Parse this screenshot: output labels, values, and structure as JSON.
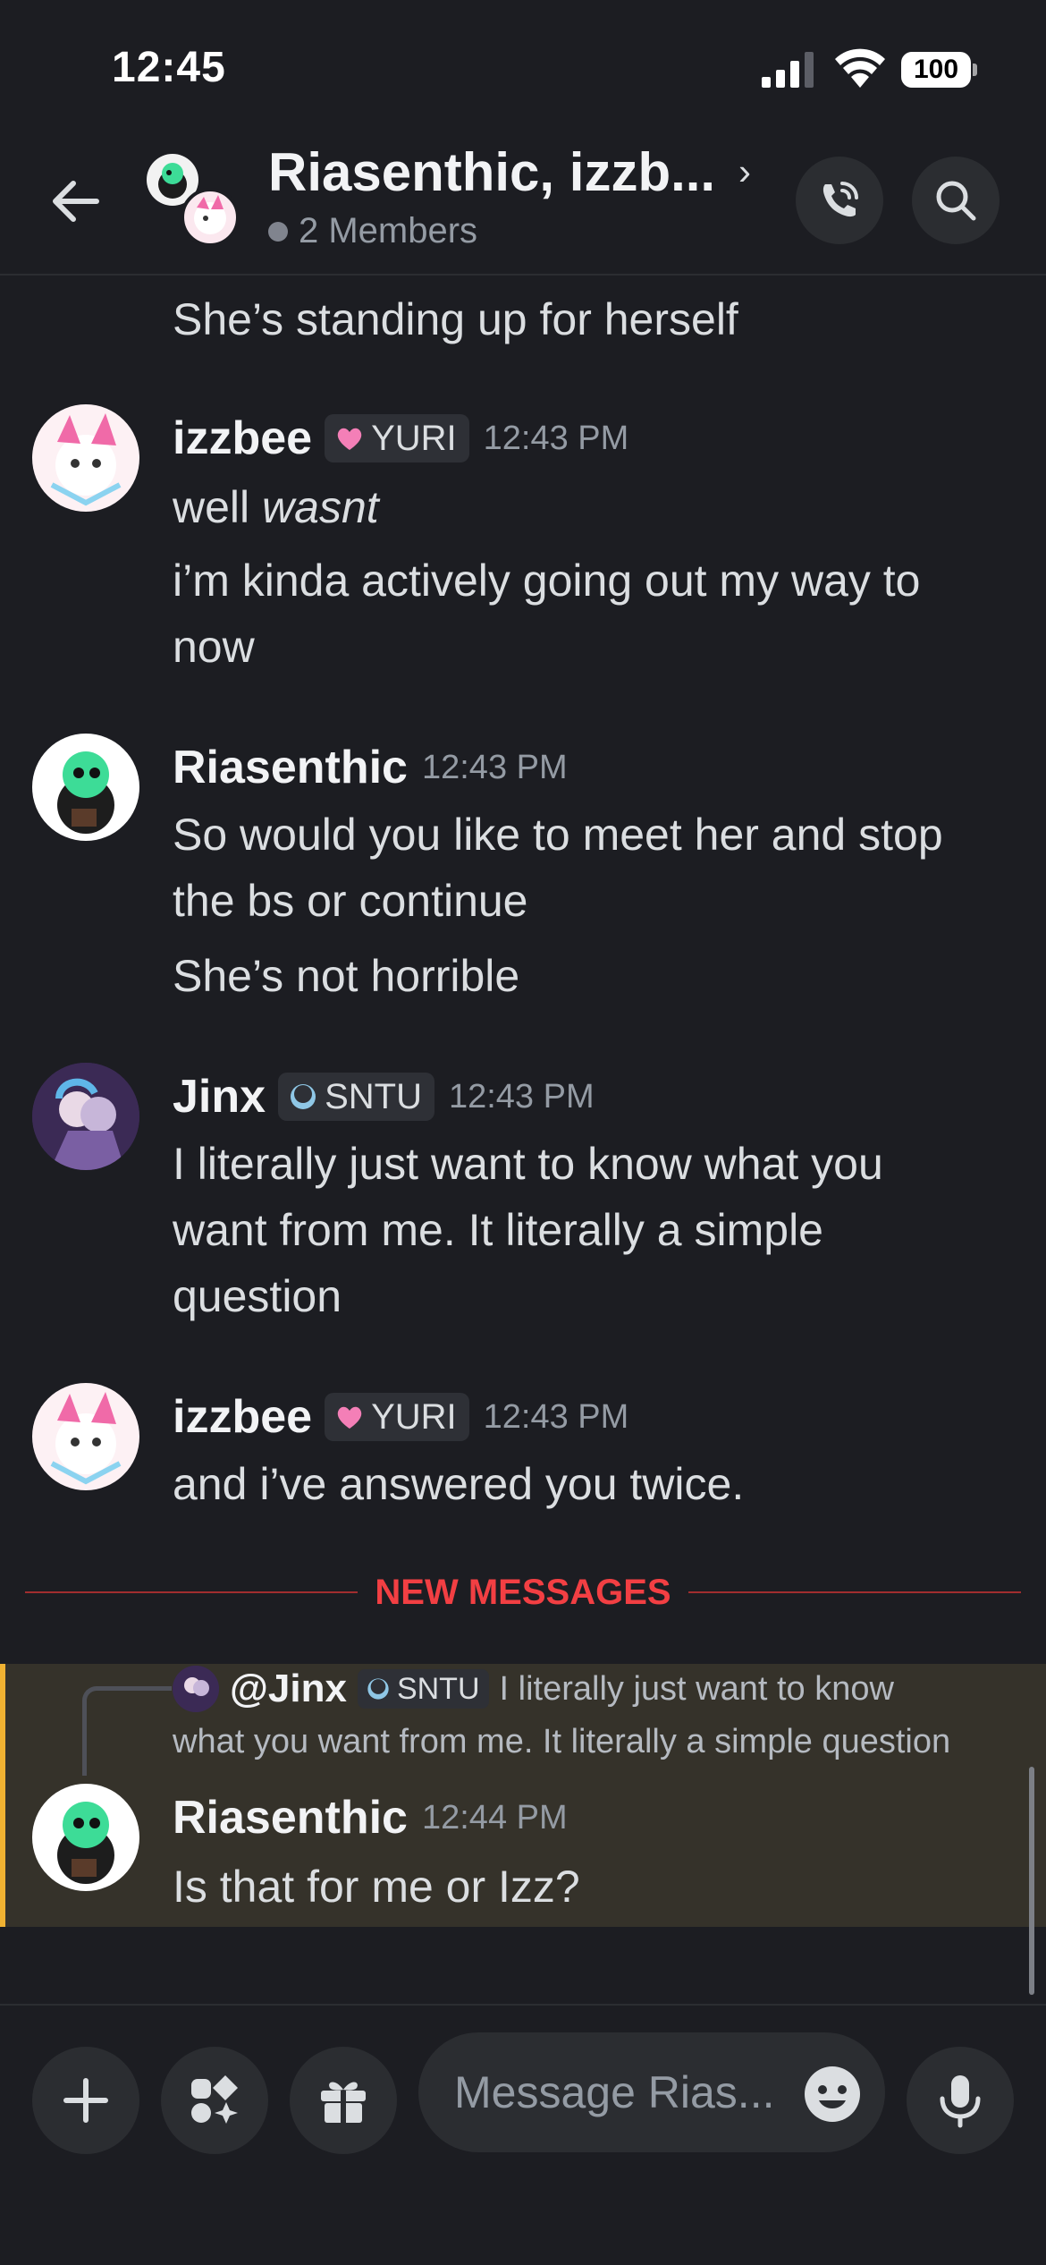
{
  "status_bar": {
    "time": "12:45",
    "battery": "100"
  },
  "header": {
    "title": "Riasenthic, izzb...",
    "members": "2 Members"
  },
  "messages": {
    "m0_text": "She’s standing up for herself",
    "g1": {
      "author": "izzbee",
      "tag": "YURI",
      "time": "12:43 PM",
      "line1_a": "well ",
      "line1_b": "wasnt",
      "line2": "i’m kinda actively going out my way to",
      "line3": "now"
    },
    "g2": {
      "author": "Riasenthic",
      "time": "12:43 PM",
      "line1": "So would you like to meet her and stop",
      "line2": "the bs or continue",
      "line3": "She’s not horrible"
    },
    "g3": {
      "author": "Jinx",
      "tag": "SNTU",
      "time": "12:43 PM",
      "line1": "I literally just want to know what you",
      "line2": "want from me. It literally a simple",
      "line3": "question"
    },
    "g4": {
      "author": "izzbee",
      "tag": "YURI",
      "time": "12:43 PM",
      "line1": "and i’ve answered you twice."
    },
    "new_messages_label": "NEW MESSAGES",
    "reply": {
      "mention": "@Jinx",
      "tag": "SNTU",
      "text_part1": "I literally just want to know",
      "text_part2": "what you want from me. It literally a simple question"
    },
    "g5": {
      "author": "Riasenthic",
      "time": "12:44 PM",
      "line1": "Is that for me or Izz?"
    }
  },
  "composer": {
    "placeholder": "Message Rias..."
  },
  "colors": {
    "background": "#1c1d22",
    "accent_new_messages": "#f23f43",
    "mention_highlight": "#35322a",
    "mention_bar": "#f0b232"
  },
  "icons": [
    "back-arrow-icon",
    "phone-call-icon",
    "search-icon",
    "plus-icon",
    "apps-icon",
    "gift-icon",
    "emoji-icon",
    "microphone-icon",
    "heart-icon",
    "moon-icon"
  ]
}
